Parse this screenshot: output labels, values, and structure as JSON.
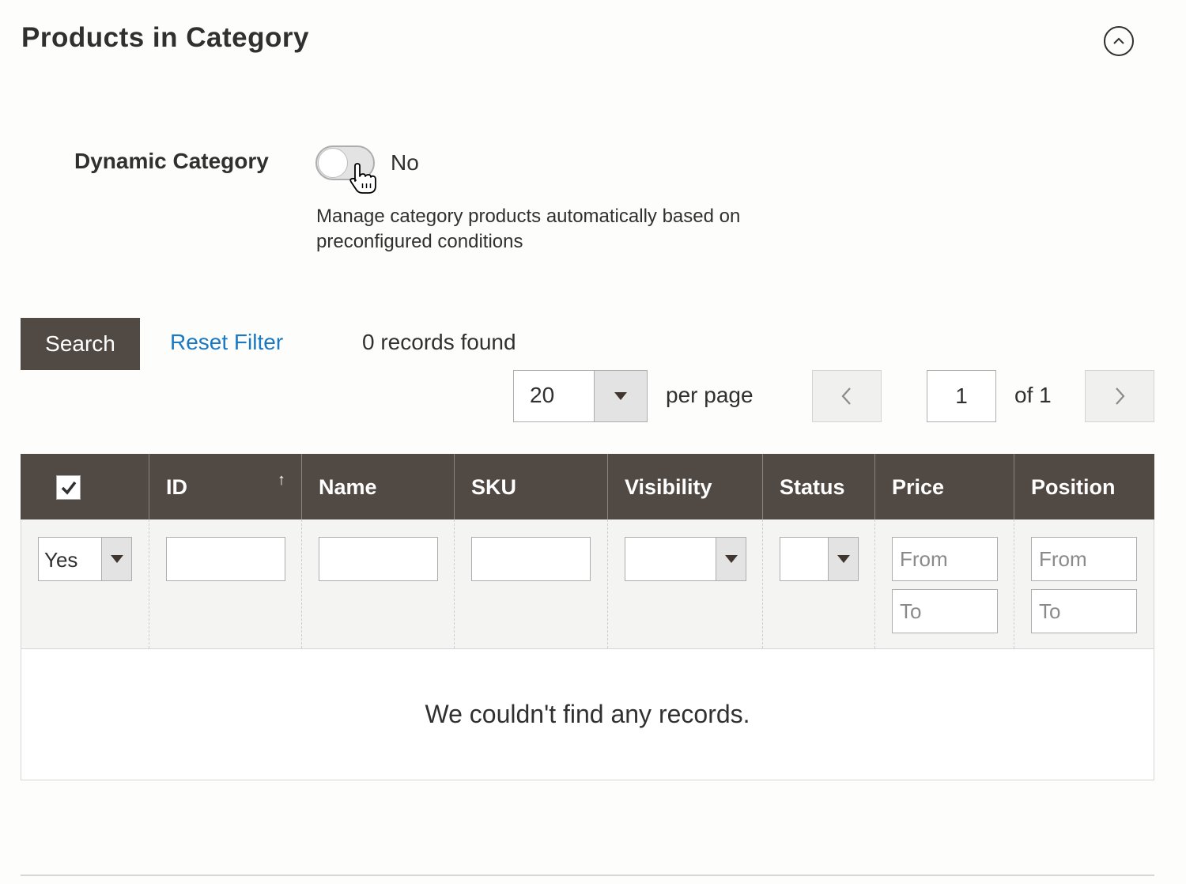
{
  "section": {
    "title": "Products in Category"
  },
  "dynamic_category": {
    "label": "Dynamic Category",
    "value": "No",
    "enabled": false,
    "note": "Manage category products automatically based on preconfigured conditions"
  },
  "actions": {
    "search_label": "Search",
    "reset_label": "Reset Filter",
    "records_found": "0 records found"
  },
  "pager": {
    "per_page": "20",
    "per_page_label": "per page",
    "current_page": "1",
    "total_label": "of 1"
  },
  "grid": {
    "columns": [
      "ID",
      "Name",
      "SKU",
      "Visibility",
      "Status",
      "Price",
      "Position"
    ],
    "sort_indicator": "↑",
    "filters": {
      "in_category": "Yes",
      "price_from_placeholder": "From",
      "price_to_placeholder": "To",
      "position_from_placeholder": "From",
      "position_to_placeholder": "To"
    },
    "empty_message": "We couldn't find any records."
  },
  "colors": {
    "header_bg": "#514943",
    "link": "#1979c3",
    "button_bg": "#514943"
  }
}
